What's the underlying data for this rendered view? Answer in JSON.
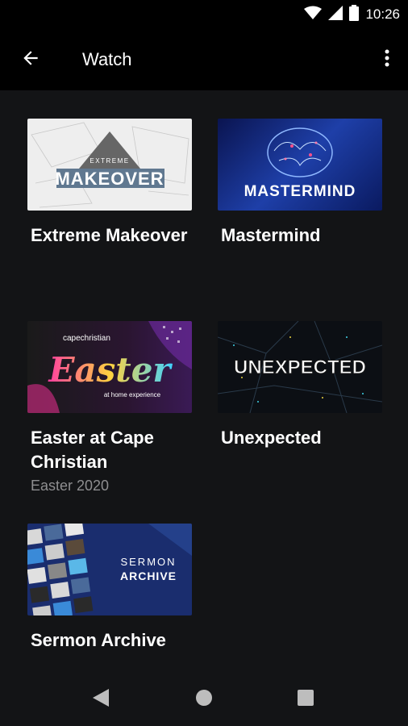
{
  "status": {
    "time": "10:26"
  },
  "appbar": {
    "title": "Watch"
  },
  "cards": [
    {
      "title": "Extreme Makeover",
      "subtitle": "",
      "thumb_top": "EXTREME",
      "thumb_main": "MAKEOVER"
    },
    {
      "title": "Mastermind",
      "subtitle": "",
      "thumb_main": "MASTERMIND"
    },
    {
      "title": "Easter at Cape Christian",
      "subtitle": "Easter 2020",
      "thumb_top": "capechristian",
      "thumb_main": "Easter",
      "thumb_sub": "at home experience"
    },
    {
      "title": "Unexpected",
      "subtitle": "",
      "thumb_main": "UNEXPECTED"
    },
    {
      "title": "Sermon Archive",
      "subtitle": "",
      "thumb_top": "SERMON",
      "thumb_main": "ARCHIVE"
    }
  ],
  "icons": {
    "back": "arrow-left-icon",
    "menu": "more-vertical-icon",
    "wifi": "wifi-icon",
    "signal": "signal-icon",
    "battery": "battery-icon",
    "nav_back": "nav-back-icon",
    "nav_home": "nav-home-icon",
    "nav_recents": "nav-recents-icon"
  }
}
